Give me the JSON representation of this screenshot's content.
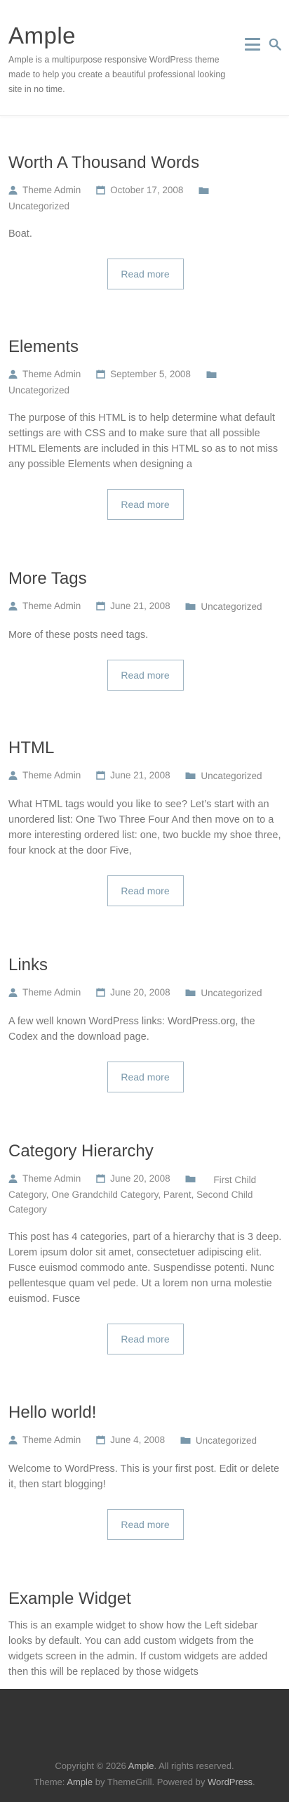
{
  "site": {
    "title": "Ample",
    "description": "Ample is a multipurpose responsive WordPress theme made to help you create a beautiful professional looking site in no time."
  },
  "posts": [
    {
      "title": "Worth A Thousand Words",
      "author": "Theme Admin",
      "date": "October 17, 2008",
      "category": "Uncategorized",
      "excerpt": "Boat.",
      "read_more": "Read more"
    },
    {
      "title": "Elements",
      "author": "Theme Admin",
      "date": "September 5, 2008",
      "category": "Uncategorized",
      "excerpt": "The purpose of this HTML is to help determine what default settings are with CSS and to make sure that all possible HTML Elements are included in this HTML so as to not miss any possible Elements when designing a",
      "read_more": "Read more"
    },
    {
      "title": "More Tags",
      "author": "Theme Admin",
      "date": "June 21, 2008",
      "category": "Uncategorized",
      "excerpt": "More of these posts need tags.",
      "read_more": "Read more"
    },
    {
      "title": "HTML",
      "author": "Theme Admin",
      "date": "June 21, 2008",
      "category": "Uncategorized",
      "excerpt": "What HTML tags would you like to see? Let’s start with an unordered list: One Two Three Four And then move on to a more interesting ordered list: one, two buckle my shoe three, four knock at the door Five,",
      "read_more": "Read more"
    },
    {
      "title": "Links",
      "author": "Theme Admin",
      "date": "June 20, 2008",
      "category": "Uncategorized",
      "excerpt": "A few well known WordPress links: WordPress.org, the Codex and the download page.",
      "read_more": "Read more"
    },
    {
      "title": "Category Hierarchy",
      "author": "Theme Admin",
      "date": "June 20, 2008",
      "category": "First Child Category, One Grandchild Category, Parent, Second Child Category",
      "excerpt": "This post has 4 categories, part of a hierarchy that is 3 deep. Lorem ipsum dolor sit amet, consectetuer adipiscing elit. Fusce euismod commodo ante. Suspendisse potenti. Nunc pellentesque quam vel pede. Ut a lorem non urna molestie euismod. Fusce",
      "read_more": "Read more"
    },
    {
      "title": "Hello world!",
      "author": "Theme Admin",
      "date": "June 4, 2008",
      "category": "Uncategorized",
      "excerpt": "Welcome to WordPress. This is your first post. Edit or delete it, then start blogging!",
      "read_more": "Read more"
    }
  ],
  "widget": {
    "title": "Example Widget",
    "text": "This is an example widget to show how the Left sidebar looks by default. You can add custom widgets from the widgets screen in the admin. If custom widgets are added then this will be replaced by those widgets"
  },
  "footer": {
    "copyright_prefix": "Copyright © 2026",
    "site_link": "Ample",
    "copyright_suffix": ". All rights reserved.",
    "theme_prefix": "Theme:",
    "theme_link": "Ample",
    "by_text": "by ThemeGrill. Powered by",
    "wp_link": "WordPress",
    "period": "."
  },
  "colors": {
    "accent": "#7a98ab",
    "footer_bg": "#333333"
  }
}
